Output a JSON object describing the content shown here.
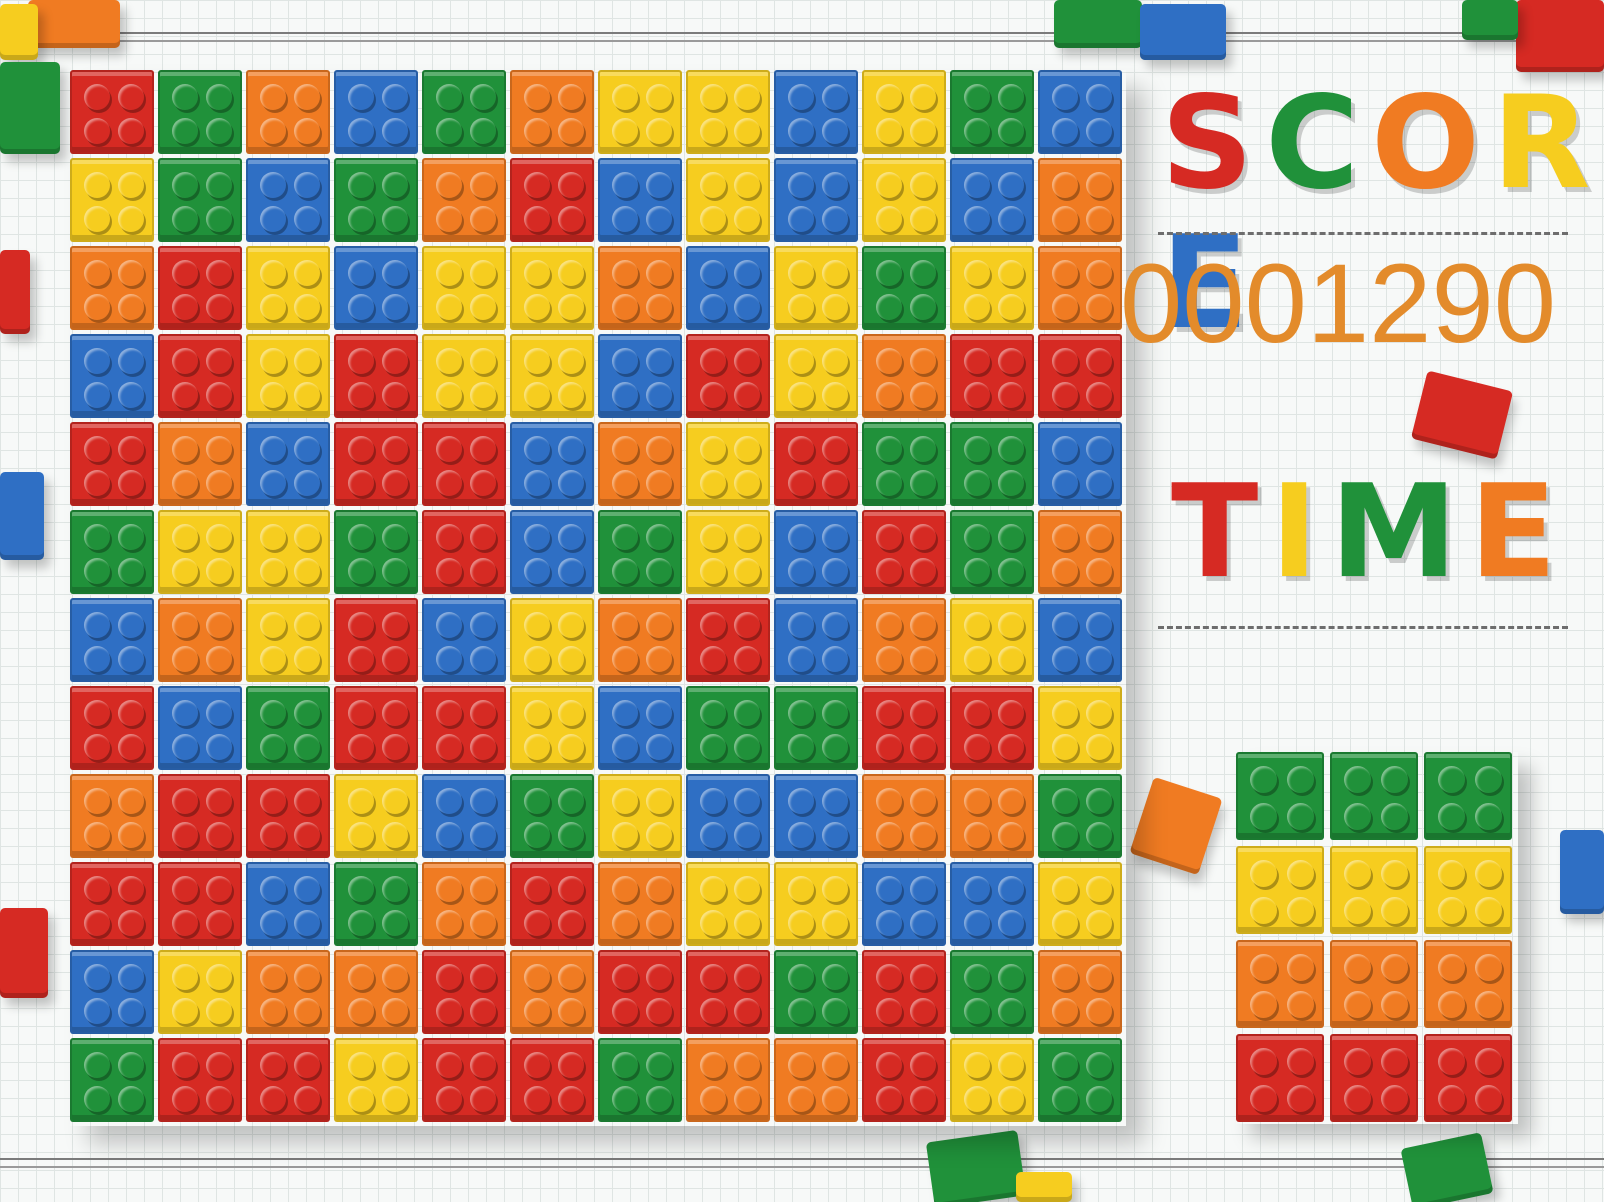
{
  "score": {
    "title_letters": [
      {
        "ch": "S",
        "color": "#d62a23"
      },
      {
        "ch": "C",
        "color": "#20913a"
      },
      {
        "ch": "O",
        "color": "#f07b22"
      },
      {
        "ch": "R",
        "color": "#f6cd1f"
      },
      {
        "ch": "E",
        "color": "#2f6fc4"
      }
    ],
    "value": "0001290"
  },
  "time": {
    "title_letters": [
      {
        "ch": "T",
        "color": "#d62a23"
      },
      {
        "ch": "I",
        "color": "#f6cd1f"
      },
      {
        "ch": "M",
        "color": "#20913a"
      },
      {
        "ch": "E",
        "color": "#f07b22"
      }
    ],
    "value": ""
  },
  "colors": {
    "R": "#d62a23",
    "G": "#20913a",
    "O": "#f07b22",
    "B": "#2f6fc4",
    "Y": "#f6cd1f"
  },
  "board": {
    "rows": [
      [
        "R",
        "G",
        "O",
        "B",
        "G",
        "O",
        "Y",
        "Y",
        "B",
        "Y",
        "G",
        "B"
      ],
      [
        "Y",
        "G",
        "B",
        "G",
        "O",
        "R",
        "B",
        "Y",
        "B",
        "Y",
        "B",
        "O"
      ],
      [
        "O",
        "R",
        "Y",
        "B",
        "Y",
        "Y",
        "O",
        "B",
        "Y",
        "G",
        "Y",
        "O"
      ],
      [
        "B",
        "R",
        "Y",
        "R",
        "Y",
        "Y",
        "B",
        "R",
        "Y",
        "O",
        "R",
        "R"
      ],
      [
        "R",
        "O",
        "B",
        "R",
        "R",
        "B",
        "O",
        "Y",
        "R",
        "G",
        "G",
        "B"
      ],
      [
        "G",
        "Y",
        "Y",
        "G",
        "R",
        "B",
        "G",
        "Y",
        "B",
        "R",
        "G",
        "O"
      ],
      [
        "B",
        "O",
        "Y",
        "R",
        "B",
        "Y",
        "O",
        "R",
        "B",
        "O",
        "Y",
        "B"
      ],
      [
        "R",
        "B",
        "G",
        "R",
        "R",
        "Y",
        "B",
        "G",
        "G",
        "R",
        "R",
        "Y"
      ],
      [
        "O",
        "R",
        "R",
        "Y",
        "B",
        "G",
        "Y",
        "B",
        "B",
        "O",
        "O",
        "G"
      ],
      [
        "R",
        "R",
        "B",
        "G",
        "O",
        "R",
        "O",
        "Y",
        "Y",
        "B",
        "B",
        "Y"
      ],
      [
        "B",
        "Y",
        "O",
        "O",
        "R",
        "O",
        "R",
        "R",
        "G",
        "R",
        "G",
        "O"
      ],
      [
        "G",
        "R",
        "R",
        "Y",
        "R",
        "R",
        "G",
        "O",
        "O",
        "R",
        "Y",
        "G"
      ]
    ]
  },
  "next_piece": {
    "rows": [
      [
        "G",
        "G",
        "G"
      ],
      [
        "Y",
        "Y",
        "Y"
      ],
      [
        "O",
        "O",
        "O"
      ],
      [
        "R",
        "R",
        "R"
      ]
    ]
  }
}
